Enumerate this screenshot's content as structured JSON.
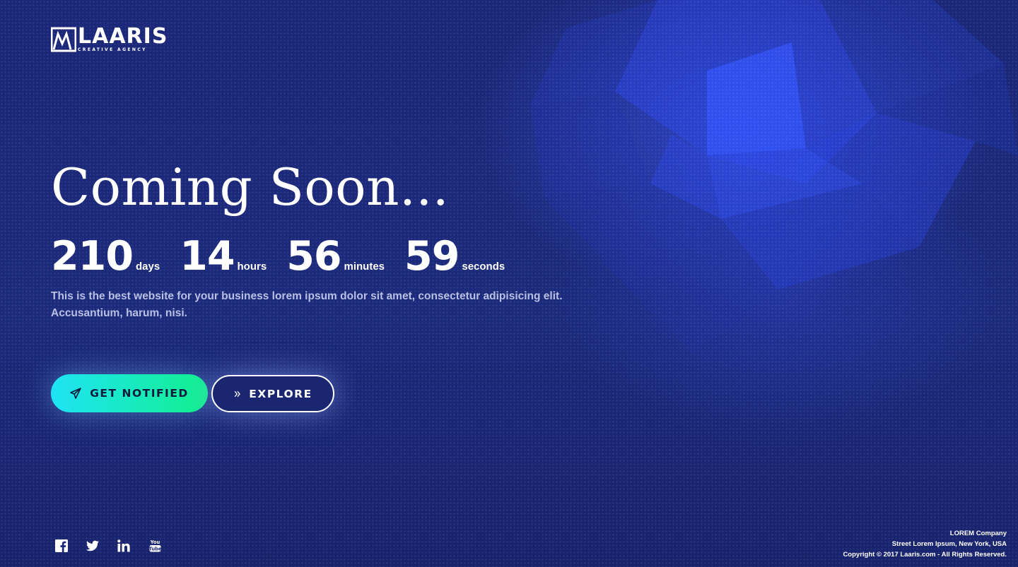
{
  "brand": {
    "name": "LAARIS",
    "tagline": "CREATIVE AGENCY"
  },
  "hero": {
    "title": "Coming Soon...",
    "description": "This is the best website for your business lorem ipsum dolor sit amet, consectetur adipisicing elit. Accusantium, harum, nisi."
  },
  "countdown": {
    "days": {
      "value": "210",
      "label": "days"
    },
    "hours": {
      "value": "14",
      "label": "hours"
    },
    "minutes": {
      "value": "56",
      "label": "minutes"
    },
    "seconds": {
      "value": "59",
      "label": "seconds"
    }
  },
  "buttons": {
    "notify_label": "GET NOTIFIED",
    "notify_icon": "paper-plane-icon",
    "explore_label": "EXPLORE",
    "explore_icon": "double-chevron-right-icon"
  },
  "social": [
    {
      "name": "facebook-icon"
    },
    {
      "name": "twitter-icon"
    },
    {
      "name": "linkedin-icon"
    },
    {
      "name": "youtube-icon"
    }
  ],
  "footer": {
    "company": "LOREM Company",
    "address": "Street Lorem Ipsum, New York, USA",
    "copyright": "Copyright © 2017 Laaris.com - All Rights Reserved."
  },
  "colors": {
    "background": "#1b2778",
    "accent_gradient_start": "#1fe3f5",
    "accent_gradient_end": "#12f08e",
    "text_muted": "#b9c0e3"
  }
}
